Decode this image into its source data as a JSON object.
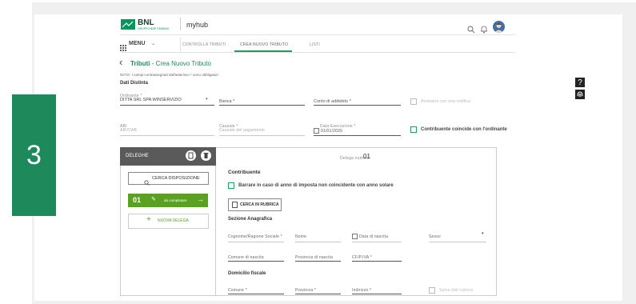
{
  "step_number": "3",
  "brand": {
    "name": "BNL",
    "group": "GRUPPO BNP PARIBAS",
    "product": "myhub"
  },
  "menu": {
    "label": "MENU",
    "items": [
      "CONTROLLA TRIBUTI",
      "CREA NUOVO TRIBUTO",
      "LISTI"
    ],
    "active_index": 1
  },
  "page": {
    "back_arrow": "‹",
    "title_strong": "Tributi",
    "title_rest": " - Crea Nuovo Tributo",
    "note": "NOTA: I campi contrassegnati dall'asterisco * sono obbligatori",
    "section": "Dati Distinta"
  },
  "distinta": {
    "ordinante_label": "Ordinante *",
    "ordinante_value": "DITTA SRL SPA WINSERVIZIO",
    "banca_label": "Banca *",
    "conto_label": "Conto di addebito *",
    "avviso_label": "Avvisami con una notifica",
    "abi_label": "ABI",
    "abi_value": "ABI/CAB",
    "causale_label": "Causale *",
    "causale_value": "Causale del pagamento",
    "data_label": "Data Esecuzione *",
    "data_value": "01/01/2020",
    "coincide_label": "Contribuente coincide con l'ordinante"
  },
  "deleghe": {
    "header": "DELEGHE",
    "cerca_label": "CERCA DISPOSIZIONE",
    "item_number": "01",
    "item_status": "da completare",
    "nuova_label": "NUOVA DELEGA"
  },
  "form": {
    "delega_label": "Delega numero",
    "delega_number": "01",
    "contribuente_title": "Contribuente",
    "barrare_label": "Barrare in caso di anno di imposta non coincidente con anno solare",
    "rubrica_label": "CERCA IN RUBRICA",
    "anagrafica_title": "Sezione Anagrafica",
    "cognome_label": "Cognome/Ragione Sociale *",
    "nome_label": "Nome",
    "data_nascita_label": "Data di nascita",
    "sesso_label": "Sesso",
    "comune_nascita_label": "Comune di nascita",
    "provincia_nascita_label": "Provincia di nascita",
    "cfpiva_label": "CF/P.IVA *",
    "domicilio_title": "Domicilio fiscale",
    "comune_label": "Comune *",
    "provincia_label": "Provincia *",
    "indirizzo_label": "Indirizzo *",
    "salva_label": "Salva dati rubrica"
  },
  "colors": {
    "green": "#1e8a5c",
    "lime": "#5aa122",
    "brand_green": "#00965e",
    "step_bg": "#1e8a5c"
  },
  "icons": [
    "search-icon",
    "bell-icon",
    "avatar-icon",
    "help-icon",
    "fingerprint-icon",
    "copy-icon",
    "trash-icon",
    "pencil-icon",
    "arrow-right-icon",
    "plus-icon",
    "calendar-icon",
    "address-book-icon",
    "grid-icon",
    "chevron-down-icon"
  ]
}
